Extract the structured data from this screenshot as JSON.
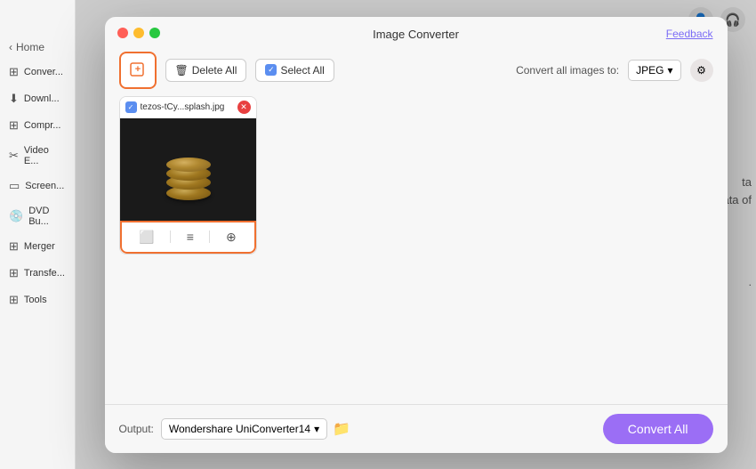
{
  "app": {
    "title": "Image Converter",
    "feedback_label": "Feedback"
  },
  "traffic_lights": {
    "red": "red",
    "yellow": "yellow",
    "green": "green"
  },
  "toolbar": {
    "add_icon": "+",
    "delete_label": "Delete All",
    "select_all_label": "Select All",
    "convert_images_to_label": "Convert all images to:",
    "format_value": "JPEG",
    "format_dropdown_icon": "▾"
  },
  "image_card": {
    "filename": "tezos-tCy...splash.jpg",
    "remove_icon": "✕",
    "check_icon": "✓"
  },
  "image_tools": {
    "crop_icon": "⬜",
    "list_icon": "≡",
    "zoom_icon": "⊕"
  },
  "bottom_bar": {
    "output_label": "Output:",
    "output_path": "Wondershare UniConverter14",
    "output_dropdown_icon": "▾",
    "folder_icon": "🗂",
    "convert_all_label": "Convert All"
  },
  "sidebar": {
    "home_label": "Home",
    "items": [
      {
        "id": "converter",
        "icon": "⊞",
        "label": "Conver..."
      },
      {
        "id": "download",
        "icon": "⬇",
        "label": "Downl..."
      },
      {
        "id": "compress",
        "icon": "⊞",
        "label": "Compr..."
      },
      {
        "id": "video-edit",
        "icon": "✂",
        "label": "Video E..."
      },
      {
        "id": "screen",
        "icon": "▭",
        "label": "Screen..."
      },
      {
        "id": "dvd",
        "icon": "💿",
        "label": "DVD Bu..."
      },
      {
        "id": "merger",
        "icon": "⊞",
        "label": "Merger"
      },
      {
        "id": "transfer",
        "icon": "⊞",
        "label": "Transfe..."
      },
      {
        "id": "tools",
        "icon": "⊞",
        "label": "Tools"
      }
    ]
  },
  "background": {
    "text1": "ta",
    "text2": "ndata of",
    "text3": "."
  }
}
